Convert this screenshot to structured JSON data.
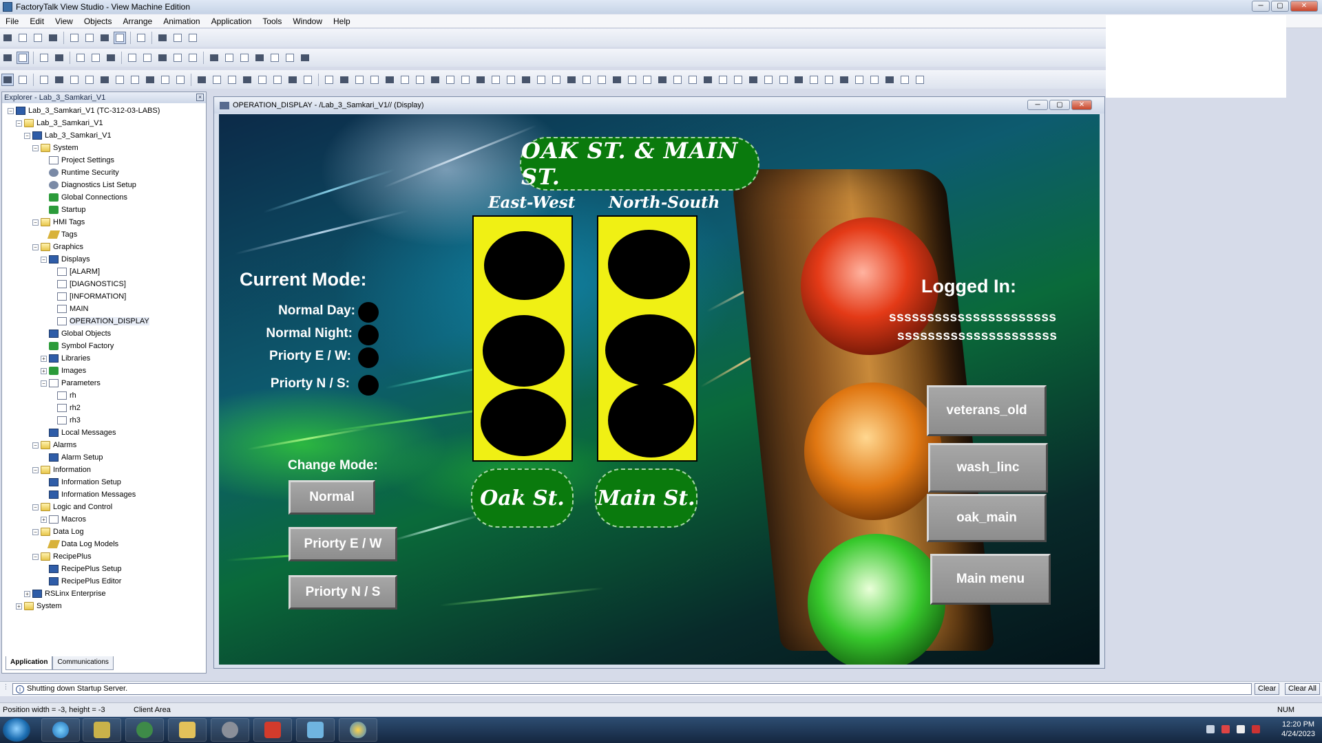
{
  "app": {
    "title": "FactoryTalk View Studio - View Machine Edition",
    "win_min": "─",
    "win_max": "▢",
    "win_close": "✕"
  },
  "menu": [
    "File",
    "Edit",
    "View",
    "Objects",
    "Arrange",
    "Animation",
    "Application",
    "Tools",
    "Window",
    "Help"
  ],
  "explorer": {
    "title": "Explorer - Lab_3_Samkari_V1",
    "close": "×",
    "tree": [
      {
        "label": "Lab_3_Samkari_V1 (TC-312-03-LABS)",
        "depth": 0,
        "exp": "−",
        "icon": "blue"
      },
      {
        "label": "Lab_3_Samkari_V1",
        "depth": 1,
        "exp": "−",
        "icon": "folder"
      },
      {
        "label": "Lab_3_Samkari_V1",
        "depth": 2,
        "exp": "−",
        "icon": "blue"
      },
      {
        "label": "System",
        "depth": 3,
        "exp": "−",
        "icon": "folder"
      },
      {
        "label": "Project Settings",
        "depth": 4,
        "exp": "",
        "icon": "doc"
      },
      {
        "label": "Runtime Security",
        "depth": 4,
        "exp": "",
        "icon": "gear"
      },
      {
        "label": "Diagnostics List Setup",
        "depth": 4,
        "exp": "",
        "icon": "gear"
      },
      {
        "label": "Global Connections",
        "depth": 4,
        "exp": "",
        "icon": "green"
      },
      {
        "label": "Startup",
        "depth": 4,
        "exp": "",
        "icon": "green"
      },
      {
        "label": "HMI Tags",
        "depth": 3,
        "exp": "−",
        "icon": "folder"
      },
      {
        "label": "Tags",
        "depth": 4,
        "exp": "",
        "icon": "pen"
      },
      {
        "label": "Graphics",
        "depth": 3,
        "exp": "−",
        "icon": "folder"
      },
      {
        "label": "Displays",
        "depth": 4,
        "exp": "−",
        "icon": "blue"
      },
      {
        "label": "[ALARM]",
        "depth": 5,
        "exp": "",
        "icon": "doc"
      },
      {
        "label": "[DIAGNOSTICS]",
        "depth": 5,
        "exp": "",
        "icon": "doc"
      },
      {
        "label": "[INFORMATION]",
        "depth": 5,
        "exp": "",
        "icon": "doc"
      },
      {
        "label": "MAIN",
        "depth": 5,
        "exp": "",
        "icon": "doc"
      },
      {
        "label": "OPERATION_DISPLAY",
        "depth": 5,
        "exp": "",
        "icon": "doc",
        "selected": true
      },
      {
        "label": "Global Objects",
        "depth": 4,
        "exp": "",
        "icon": "blue"
      },
      {
        "label": "Symbol Factory",
        "depth": 4,
        "exp": "",
        "icon": "green"
      },
      {
        "label": "Libraries",
        "depth": 4,
        "exp": "+",
        "icon": "blue"
      },
      {
        "label": "Images",
        "depth": 4,
        "exp": "+",
        "icon": "green"
      },
      {
        "label": "Parameters",
        "depth": 4,
        "exp": "−",
        "icon": "doc"
      },
      {
        "label": "rh",
        "depth": 5,
        "exp": "",
        "icon": "doc"
      },
      {
        "label": "rh2",
        "depth": 5,
        "exp": "",
        "icon": "doc"
      },
      {
        "label": "rh3",
        "depth": 5,
        "exp": "",
        "icon": "doc"
      },
      {
        "label": "Local Messages",
        "depth": 4,
        "exp": "",
        "icon": "blue"
      },
      {
        "label": "Alarms",
        "depth": 3,
        "exp": "−",
        "icon": "folder"
      },
      {
        "label": "Alarm Setup",
        "depth": 4,
        "exp": "",
        "icon": "blue"
      },
      {
        "label": "Information",
        "depth": 3,
        "exp": "−",
        "icon": "folder"
      },
      {
        "label": "Information Setup",
        "depth": 4,
        "exp": "",
        "icon": "blue"
      },
      {
        "label": "Information Messages",
        "depth": 4,
        "exp": "",
        "icon": "blue"
      },
      {
        "label": "Logic and Control",
        "depth": 3,
        "exp": "−",
        "icon": "folder"
      },
      {
        "label": "Macros",
        "depth": 4,
        "exp": "+",
        "icon": "doc"
      },
      {
        "label": "Data Log",
        "depth": 3,
        "exp": "−",
        "icon": "folder"
      },
      {
        "label": "Data Log Models",
        "depth": 4,
        "exp": "",
        "icon": "pen"
      },
      {
        "label": "RecipePlus",
        "depth": 3,
        "exp": "−",
        "icon": "folder"
      },
      {
        "label": "RecipePlus Setup",
        "depth": 4,
        "exp": "",
        "icon": "blue"
      },
      {
        "label": "RecipePlus Editor",
        "depth": 4,
        "exp": "",
        "icon": "blue"
      },
      {
        "label": "RSLinx Enterprise",
        "depth": 2,
        "exp": "+",
        "icon": "blue"
      },
      {
        "label": "System",
        "depth": 1,
        "exp": "+",
        "icon": "folder"
      }
    ],
    "tabs": [
      "Application",
      "Communications"
    ]
  },
  "display": {
    "window_title": "OPERATION_DISPLAY - /Lab_3_Samkari_V1// (Display)",
    "intersection_title": "OAK ST. & MAIN ST.",
    "east_west_label": "East-West",
    "north_south_label": "North-South",
    "oak_label": "Oak St.",
    "main_label": "Main St.",
    "current_mode_title": "Current Mode:",
    "modes": [
      "Normal Day:",
      "Normal Night:",
      "Priorty E / W:",
      "Priorty N / S:"
    ],
    "change_mode_title": "Change Mode:",
    "change_buttons": [
      "Normal",
      "Priorty E / W",
      "Priorty N / S"
    ],
    "logged_in_title": "Logged In:",
    "logged_user_1": "ssssssssssssssssssssss",
    "logged_user_2": "sssssssssssssssssssss",
    "nav_buttons": [
      "veterans_old",
      "wash_linc",
      "oak_main",
      "Main menu"
    ],
    "lamp_color": "#000000",
    "panel_color": "#f0f014",
    "banner_color": "#0a7a0d"
  },
  "output": {
    "message": "Shutting down Startup Server.",
    "clear": "Clear",
    "clear_all": "Clear All"
  },
  "status": {
    "position": "Position width = -3, height = -3",
    "area": "Client Area",
    "num": "NUM"
  },
  "taskbar": {
    "time": "12:20 PM",
    "date": "4/24/2023"
  }
}
